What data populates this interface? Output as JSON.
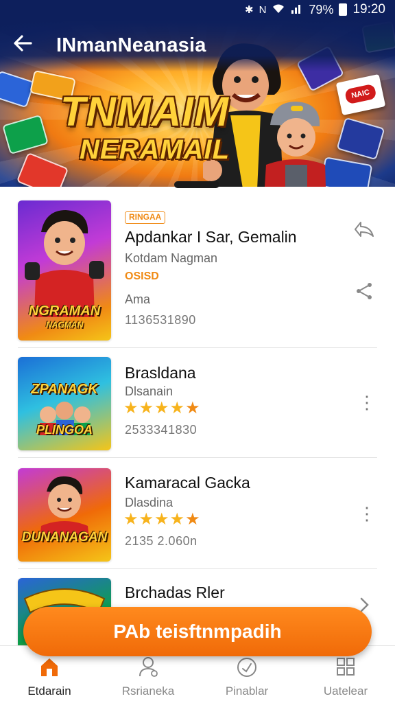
{
  "status_bar": {
    "battery": "79%",
    "time": "19:20"
  },
  "header": {
    "title": "INmanNeanasia",
    "back_icon": "back-arrow-icon"
  },
  "hero": {
    "logo_line1": "TNMAIM",
    "logo_line2": "NERAMAIL",
    "card_logo_text": "NAIC"
  },
  "colors": {
    "accent": "#f08a14",
    "header_bg": "#0d1f5c",
    "star": "#f7b31c"
  },
  "items": [
    {
      "badge": "RINGAA",
      "title": "Apdankar I Sar, Gemalin",
      "subtitle": "Kotdam Nagman",
      "tag": "OSISD",
      "meta": "Ama",
      "number": "1136531890",
      "thumb_text1": "NGRAMAN",
      "thumb_text2": "NAGMAN",
      "actions": [
        "share-arrow-icon",
        "share-icon"
      ]
    },
    {
      "title": "Brasldana",
      "subtitle": "Dlsanain",
      "rating": 5,
      "number": "2533341830",
      "thumb_text1": "ZPANAGK",
      "thumb_text2": "PLINGOA"
    },
    {
      "title": "Kamaracal Gacka",
      "subtitle": "Dlasdina",
      "rating": 5,
      "number": "2135 2.060n",
      "thumb_text1": "DUNANAGAN"
    },
    {
      "title": "Brchadas Rler"
    }
  ],
  "fab": {
    "label": "PAb teisftnmpadih"
  },
  "bottom_nav": [
    {
      "label": "Etdarain",
      "icon": "home-icon",
      "active": true
    },
    {
      "label": "Rsrianeka",
      "icon": "profile-icon",
      "active": false
    },
    {
      "label": "Pinablar",
      "icon": "clock-icon",
      "active": false
    },
    {
      "label": "Uatelear",
      "icon": "grid-icon",
      "active": false
    }
  ]
}
